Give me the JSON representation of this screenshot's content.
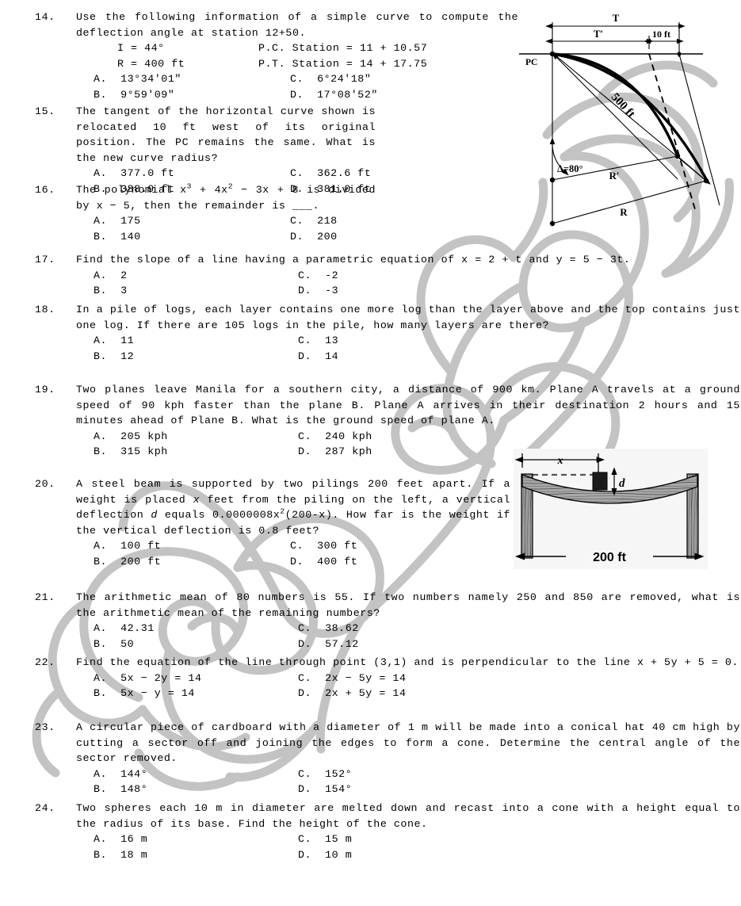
{
  "document": {
    "kind": "exam-question-sheet",
    "watermark_color": "#c4c4c4"
  },
  "questions": [
    {
      "number": "14.",
      "stem": "Use the following information of a simple curve to compute the deflection angle at station 12+50.",
      "givens": [
        {
          "left": "I = 44°",
          "right": "P.C. Station = 11 + 10.57"
        },
        {
          "left": "R = 400 ft",
          "right": "P.T. Station = 14 + 17.75"
        }
      ],
      "choices": [
        {
          "a_label": "A.",
          "a_text": "13°34′01″",
          "b_label": "C.",
          "b_text": "6°24′18″"
        },
        {
          "a_label": "B.",
          "a_text": "9°59′09″",
          "b_label": "D.",
          "b_text": "17°08′52″"
        }
      ]
    },
    {
      "number": "15.",
      "stem": "The tangent of the horizontal curve shown is relocated 10 ft west of its original position. The PC remains the same. What is the new curve radius?",
      "choices": [
        {
          "a_label": "A.",
          "a_text": "377.0 ft",
          "b_label": "C.",
          "b_text": "362.6 ft"
        },
        {
          "a_label": "B.",
          "a_text": "388.9 ft",
          "b_label": "D.",
          "b_text": "381.0 ft"
        }
      ]
    },
    {
      "number": "16.",
      "stem_html": "The polynomial x<sup>3</sup> + 4x<sup>2</sup> − 3x + 8 is divided by x − 5, then the remainder is ___.",
      "choices": [
        {
          "a_label": "A.",
          "a_text": "175",
          "b_label": "C.",
          "b_text": "218"
        },
        {
          "a_label": "B.",
          "a_text": "140",
          "b_label": "D.",
          "b_text": "200"
        }
      ]
    },
    {
      "number": "17.",
      "stem": "Find the slope of a line having a parametric equation of x = 2 + t and y = 5 − 3t.",
      "choices": [
        {
          "a_label": "A.",
          "a_text": "2",
          "b_label": "C.",
          "b_text": "-2"
        },
        {
          "a_label": "B.",
          "a_text": "3",
          "b_label": "D.",
          "b_text": "-3"
        }
      ]
    },
    {
      "number": "18.",
      "stem": "In a pile of logs, each layer contains one more log than the layer above and the top contains just one log. If there are 105 logs in the pile, how many layers are there?",
      "choices": [
        {
          "a_label": "A.",
          "a_text": "11",
          "b_label": "C.",
          "b_text": "13"
        },
        {
          "a_label": "B.",
          "a_text": "12",
          "b_label": "D.",
          "b_text": "14"
        }
      ]
    },
    {
      "number": "19.",
      "stem": "Two planes leave Manila for a southern city, a distance of 900 km. Plane A travels at a ground speed of 90 kph faster than the plane B. Plane A arrives in their destination 2 hours and 15 minutes ahead of Plane B. What is the ground speed of plane A.",
      "choices": [
        {
          "a_label": "A.",
          "a_text": "205 kph",
          "b_label": "C.",
          "b_text": "240 kph"
        },
        {
          "a_label": "B.",
          "a_text": "315 kph",
          "b_label": "D.",
          "b_text": "287 kph"
        }
      ]
    },
    {
      "number": "20.",
      "stem_html": "A steel beam is supported by two pilings 200 feet apart. If a weight is placed <i>x</i> feet from the piling on the left, a vertical deflection <i>d</i> equals 0.0000008x<sup>2</sup>(200-x). How far is the weight if the vertical deflection is 0.8 feet?",
      "choices": [
        {
          "a_label": "A.",
          "a_text": "100 ft",
          "b_label": "C.",
          "b_text": "300 ft"
        },
        {
          "a_label": "B.",
          "a_text": "200 ft",
          "b_label": "D.",
          "b_text": "400 ft"
        }
      ]
    },
    {
      "number": "21.",
      "stem": "The arithmetic mean of 80 numbers is 55. If two numbers namely 250 and 850 are removed, what is the arithmetic mean of the remaining numbers?",
      "choices": [
        {
          "a_label": "A.",
          "a_text": "42.31",
          "b_label": "C.",
          "b_text": "38.62"
        },
        {
          "a_label": "B.",
          "a_text": "50",
          "b_label": "D.",
          "b_text": "57.12"
        }
      ]
    },
    {
      "number": "22.",
      "stem": "Find the equation of the line through point (3,1) and is perpendicular to the line x + 5y + 5 = 0.",
      "choices": [
        {
          "a_label": "A.",
          "a_text": "5x − 2y = 14",
          "b_label": "C.",
          "b_text": "2x − 5y = 14"
        },
        {
          "a_label": "B.",
          "a_text": "5x − y = 14",
          "b_label": "D.",
          "b_text": "2x + 5y = 14"
        }
      ]
    },
    {
      "number": "23.",
      "stem": "A circular piece of cardboard with a diameter of 1 m will be made into a conical hat 40 cm high by cutting a sector off and joining the edges to form a cone. Determine the central angle of the sector removed.",
      "choices": [
        {
          "a_label": "A.",
          "a_text": "144°",
          "b_label": "C.",
          "b_text": "152°"
        },
        {
          "a_label": "B.",
          "a_text": "148°",
          "b_label": "D.",
          "b_text": "154°"
        }
      ]
    },
    {
      "number": "24.",
      "stem": "Two spheres each 10 m in diameter are melted down and recast into a cone with a height equal to the radius of its base. Find the height of the cone.",
      "choices": [
        {
          "a_label": "A.",
          "a_text": "16 m",
          "b_label": "C.",
          "b_text": "15 m"
        },
        {
          "a_label": "B.",
          "a_text": "18 m",
          "b_label": "D.",
          "b_text": "10 m"
        }
      ]
    }
  ],
  "figures": {
    "curve_diagram": {
      "name": "horizontal-curve-diagram",
      "labels": {
        "tangent_full": "T",
        "tangent_new": "T′",
        "offset": "10 ft",
        "pc": "PC",
        "chord": "500 ft",
        "delta": "Δ=80°",
        "radius_new": "R′",
        "radius_orig": "R"
      }
    },
    "beam_diagram": {
      "name": "steel-beam-deflection-diagram",
      "labels": {
        "distance_x": "x",
        "deflection_d": "d",
        "span": "200 ft"
      }
    }
  }
}
